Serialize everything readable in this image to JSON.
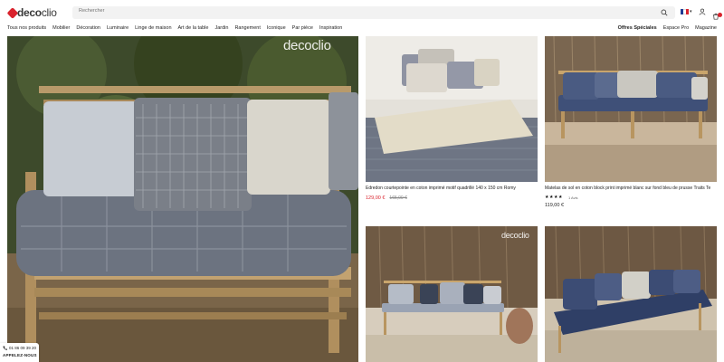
{
  "brand": {
    "logo_primary": "deco",
    "logo_secondary": "clio",
    "accent": "#d9232d"
  },
  "search": {
    "placeholder": "Rechercher"
  },
  "header_icons": [
    "flag-fr-icon",
    "user-icon",
    "cart-icon"
  ],
  "nav": {
    "items": [
      "Tous nos produits",
      "Mobilier",
      "Décoration",
      "Luminaire",
      "Linge de maison",
      "Art de la table",
      "Jardin",
      "Rangement",
      "Iconique",
      "Par pièce",
      "Inspiration"
    ],
    "right": [
      "Offres Spéciales",
      "Espace Pro",
      "Magazine"
    ]
  },
  "hero": {
    "watermark_primary": "deco",
    "watermark_secondary": "clio"
  },
  "products": [
    {
      "name": "Edredon courtepointe en coton imprimé motif quadrillé 140 x 150 cm Romy",
      "price_sale": "129,00 €",
      "price_old": "165,00 €"
    },
    {
      "name": "Matelas de sol en coton block print imprimé blanc sur fond bleu de prusse Traits Te",
      "stars": "★★★★",
      "reviews": "1 Avis",
      "price": "119,00 €"
    }
  ],
  "tile3": {
    "watermark_primary": "deco",
    "watermark_secondary": "clio"
  },
  "contact": {
    "phone": "01 86 09 39 20",
    "call_label": "APPELEZ-NOUS"
  }
}
